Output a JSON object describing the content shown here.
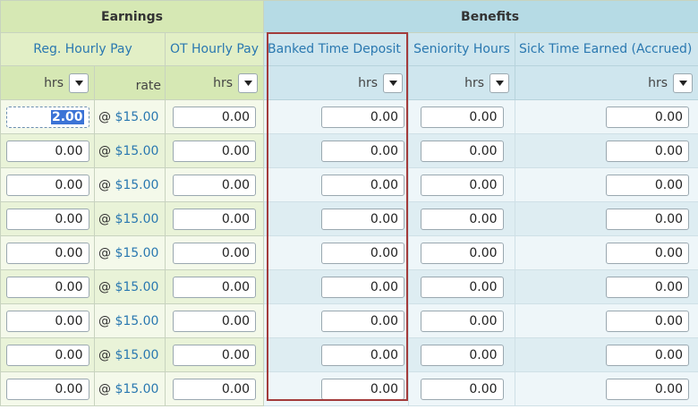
{
  "groups": {
    "earnings": "Earnings",
    "benefits": "Benefits"
  },
  "columns": {
    "reg_hourly_pay": "Reg. Hourly Pay",
    "ot_hourly_pay": "OT Hourly Pay",
    "banked_time_deposit": "Banked Time Deposit",
    "seniority_hours": "Seniority Hours",
    "sick_time_earned": "Sick Time Earned (Accrued)"
  },
  "units": {
    "hrs": "hrs",
    "rate": "rate"
  },
  "rows": [
    {
      "reg_hrs": "2.00",
      "at": "@",
      "rate": "$15.00",
      "ot": "0.00",
      "banked": "0.00",
      "seniority": "0.00",
      "sick": "0.00"
    },
    {
      "reg_hrs": "0.00",
      "at": "@",
      "rate": "$15.00",
      "ot": "0.00",
      "banked": "0.00",
      "seniority": "0.00",
      "sick": "0.00"
    },
    {
      "reg_hrs": "0.00",
      "at": "@",
      "rate": "$15.00",
      "ot": "0.00",
      "banked": "0.00",
      "seniority": "0.00",
      "sick": "0.00"
    },
    {
      "reg_hrs": "0.00",
      "at": "@",
      "rate": "$15.00",
      "ot": "0.00",
      "banked": "0.00",
      "seniority": "0.00",
      "sick": "0.00"
    },
    {
      "reg_hrs": "0.00",
      "at": "@",
      "rate": "$15.00",
      "ot": "0.00",
      "banked": "0.00",
      "seniority": "0.00",
      "sick": "0.00"
    },
    {
      "reg_hrs": "0.00",
      "at": "@",
      "rate": "$15.00",
      "ot": "0.00",
      "banked": "0.00",
      "seniority": "0.00",
      "sick": "0.00"
    },
    {
      "reg_hrs": "0.00",
      "at": "@",
      "rate": "$15.00",
      "ot": "0.00",
      "banked": "0.00",
      "seniority": "0.00",
      "sick": "0.00"
    },
    {
      "reg_hrs": "0.00",
      "at": "@",
      "rate": "$15.00",
      "ot": "0.00",
      "banked": "0.00",
      "seniority": "0.00",
      "sick": "0.00"
    },
    {
      "reg_hrs": "0.00",
      "at": "@",
      "rate": "$15.00",
      "ot": "0.00",
      "banked": "0.00",
      "seniority": "0.00",
      "sick": "0.00"
    }
  ],
  "colors": {
    "earnings_header": "#d6e8b4",
    "benefits_header": "#b6dbe5",
    "link_blue": "#2a78b0",
    "highlight_box": "#a33b3b",
    "selection": "#3b73d6"
  },
  "icons": {
    "unit_dropdown": "chevron-down-icon"
  }
}
